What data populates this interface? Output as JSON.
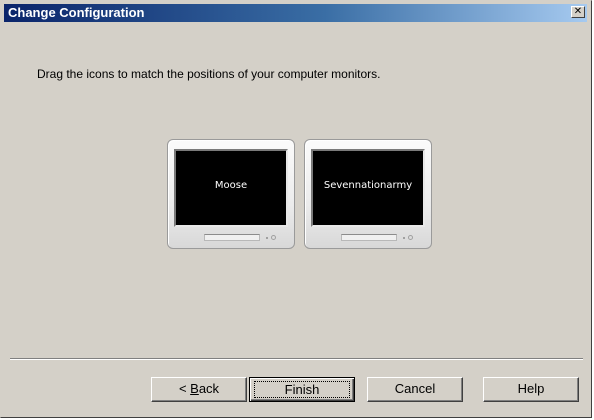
{
  "window": {
    "title": "Change Configuration",
    "close_glyph": "✕"
  },
  "instruction": "Drag the icons to match the positions of your computer monitors.",
  "monitors": [
    {
      "label": "Moose"
    },
    {
      "label": "Sevennationarmy"
    }
  ],
  "buttons": {
    "back_prefix": "< ",
    "back_mnemonic": "B",
    "back_rest": "ack",
    "finish": "Finish",
    "cancel": "Cancel",
    "help": "Help"
  },
  "icons": {
    "monitor": "monitor-icon",
    "close": "close-icon"
  },
  "colors": {
    "titlebar_start": "#0a246a",
    "titlebar_end": "#a6caf0",
    "dialog_face": "#d4d0c8",
    "screen": "#000000"
  }
}
